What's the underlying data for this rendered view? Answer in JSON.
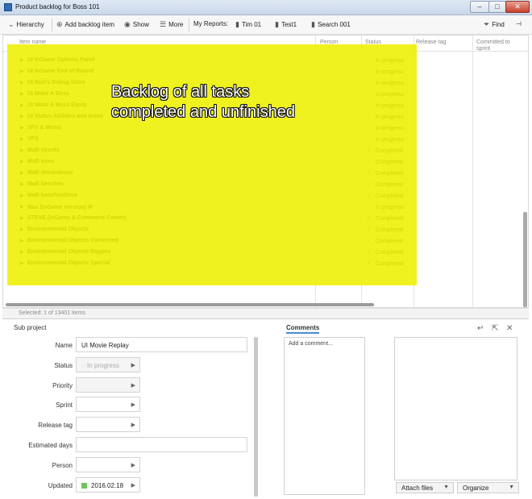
{
  "window": {
    "title": "Product backlog for Boss 101",
    "minimize": "–",
    "maximize": "□",
    "close": "✕"
  },
  "toolbar": {
    "hierarchy": "Hierarchy",
    "add_backlog": "Add backlog item",
    "show": "Show",
    "more": "More",
    "my_reports": "My Reports:",
    "report1": "Tim 01",
    "report2": "Test1",
    "report3": "Search 001",
    "find": "Find"
  },
  "grid": {
    "columns": {
      "item_name": "Item name",
      "person": "Person",
      "status": "Status",
      "release_tag": "Release tag",
      "committed": "Committed to sprint"
    },
    "rows": [
      {
        "name": "UI InGame Options Panel",
        "status": "In progress",
        "state": "prog"
      },
      {
        "name": "UI InGame End of Round",
        "status": "In progress",
        "state": "prog"
      },
      {
        "name": "UI Rob's Debug Store",
        "status": "In progress",
        "state": "prog"
      },
      {
        "name": "UI Make A Boss",
        "status": "In progress",
        "state": "prog"
      },
      {
        "name": "UI Make A Boss Equip",
        "status": "In progress",
        "state": "prog"
      },
      {
        "name": "UI Status Abilities and Icons",
        "status": "In progress",
        "state": "prog"
      },
      {
        "name": "SFX & Music",
        "status": "In progress",
        "state": "prog"
      },
      {
        "name": "VFX",
        "status": "In progress",
        "state": "prog"
      },
      {
        "name": "MaB streets",
        "status": "Completed",
        "state": "done"
      },
      {
        "name": "MaB trees",
        "status": "Completed",
        "state": "done"
      },
      {
        "name": "MaB decorations",
        "status": "Completed",
        "state": "done"
      },
      {
        "name": "MaB benches",
        "status": "Completed",
        "state": "done"
      },
      {
        "name": "MaB benchesDeco",
        "status": "Completed",
        "state": "done"
      },
      {
        "name": "Max (InGame Version) ✉",
        "status": "In progress",
        "state": "prog"
      },
      {
        "name": "STEVE (InGame & Command Center)",
        "status": "Completed",
        "state": "done"
      },
      {
        "name": "Environmental Objects",
        "status": "Completed",
        "state": "done"
      },
      {
        "name": "Environmental Objects Converted",
        "status": "Completed",
        "state": "done"
      },
      {
        "name": "Environmental Objects Biggies",
        "status": "Completed",
        "state": "done"
      },
      {
        "name": "Environmental Objects Special",
        "status": "Completed",
        "state": "done"
      }
    ],
    "selection_info": "Selected: 1 of 13401 items"
  },
  "annotation": {
    "line1": "Backlog of all tasks",
    "line2": "completed and unfinished",
    "color": "#eef000"
  },
  "detail": {
    "section": "Sub project",
    "name_label": "Name",
    "name_value": "UI Movie Replay",
    "status_label": "Status",
    "status_value": "In progress",
    "priority_label": "Priority",
    "sprint_label": "Sprint",
    "release_label": "Release tag",
    "estimated_label": "Estimated days",
    "person_label": "Person",
    "updated_label": "Updated",
    "updated_value": "2016.02.18"
  },
  "comments": {
    "tab": "Comments",
    "placeholder": "Add a comment..."
  },
  "attachments": {
    "attach": "Attach files",
    "organize": "Organize"
  }
}
